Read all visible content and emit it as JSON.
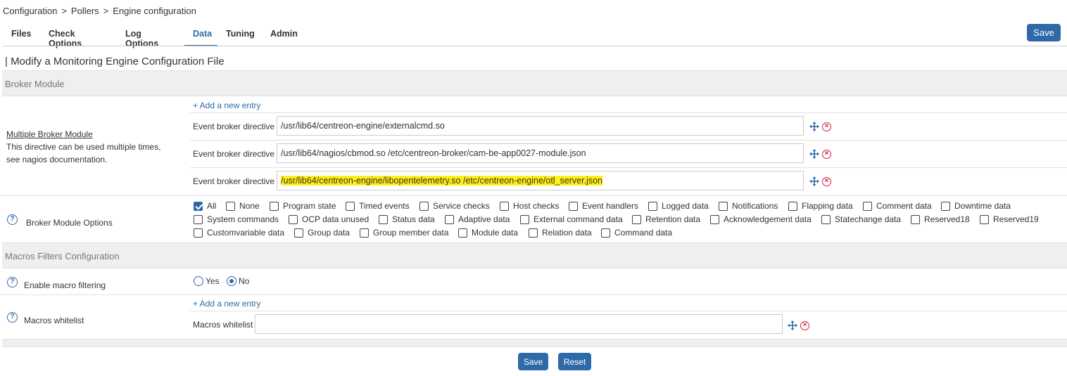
{
  "breadcrumb": [
    "Configuration",
    "Pollers",
    "Engine configuration"
  ],
  "breadcrumb_sep": ">",
  "tabs": [
    {
      "label": "Files"
    },
    {
      "label": "Check Options"
    },
    {
      "label": "Log Options"
    },
    {
      "label": "Data",
      "active": true
    },
    {
      "label": "Tuning"
    },
    {
      "label": "Admin"
    }
  ],
  "save_top": "Save",
  "page_title": "| Modify a Monitoring Engine Configuration File",
  "broker_section": "Broker Module",
  "multi_broker": {
    "title": "Multiple Broker Module",
    "desc_line1": "This directive can be used multiple times,",
    "desc_line2": "see nagios documentation.",
    "add_entry": "+ Add a new entry",
    "entry_label": "Event broker directive",
    "entries": [
      "/usr/lib64/centreon-engine/externalcmd.so",
      "/usr/lib64/nagios/cbmod.so /etc/centreon-broker/cam-be-app0027-module.json",
      "/usr/lib64/centreon-engine/libopentelemetry.so /etc/centreon-engine/otl_server.json"
    ]
  },
  "broker_options": {
    "label": "Broker Module Options",
    "options": [
      {
        "label": "All",
        "checked": true
      },
      {
        "label": "None",
        "checked": false
      },
      {
        "label": "Program state",
        "checked": false
      },
      {
        "label": "Timed events",
        "checked": false
      },
      {
        "label": "Service checks",
        "checked": false
      },
      {
        "label": "Host checks",
        "checked": false
      },
      {
        "label": "Event handlers",
        "checked": false
      },
      {
        "label": "Logged data",
        "checked": false
      },
      {
        "label": "Notifications",
        "checked": false
      },
      {
        "label": "Flapping data",
        "checked": false
      },
      {
        "label": "Comment data",
        "checked": false
      },
      {
        "label": "Downtime data",
        "checked": false
      },
      {
        "label": "System commands",
        "checked": false
      },
      {
        "label": "OCP data unused",
        "checked": false
      },
      {
        "label": "Status data",
        "checked": false
      },
      {
        "label": "Adaptive data",
        "checked": false
      },
      {
        "label": "External command data",
        "checked": false
      },
      {
        "label": "Retention data",
        "checked": false
      },
      {
        "label": "Acknowledgement data",
        "checked": false
      },
      {
        "label": "Statechange data",
        "checked": false
      },
      {
        "label": "Reserved18",
        "checked": false
      },
      {
        "label": "Reserved19",
        "checked": false
      },
      {
        "label": "Customvariable data",
        "checked": false
      },
      {
        "label": "Group data",
        "checked": false
      },
      {
        "label": "Group member data",
        "checked": false
      },
      {
        "label": "Module data",
        "checked": false
      },
      {
        "label": "Relation data",
        "checked": false
      },
      {
        "label": "Command data",
        "checked": false
      }
    ]
  },
  "macros_section": "Macros Filters Configuration",
  "macro_filtering": {
    "label": "Enable macro filtering",
    "yes": "Yes",
    "no": "No",
    "selected": "No"
  },
  "macros_whitelist": {
    "label": "Macros whitelist",
    "add_entry": "+ Add a new entry",
    "field_label": "Macros whitelist",
    "value": ""
  },
  "footer": {
    "save": "Save",
    "reset": "Reset"
  },
  "colors": {
    "accent": "#2e6aa8",
    "highlight": "#ffef16",
    "delete": "#d0203a",
    "section_bg": "#efefef"
  }
}
